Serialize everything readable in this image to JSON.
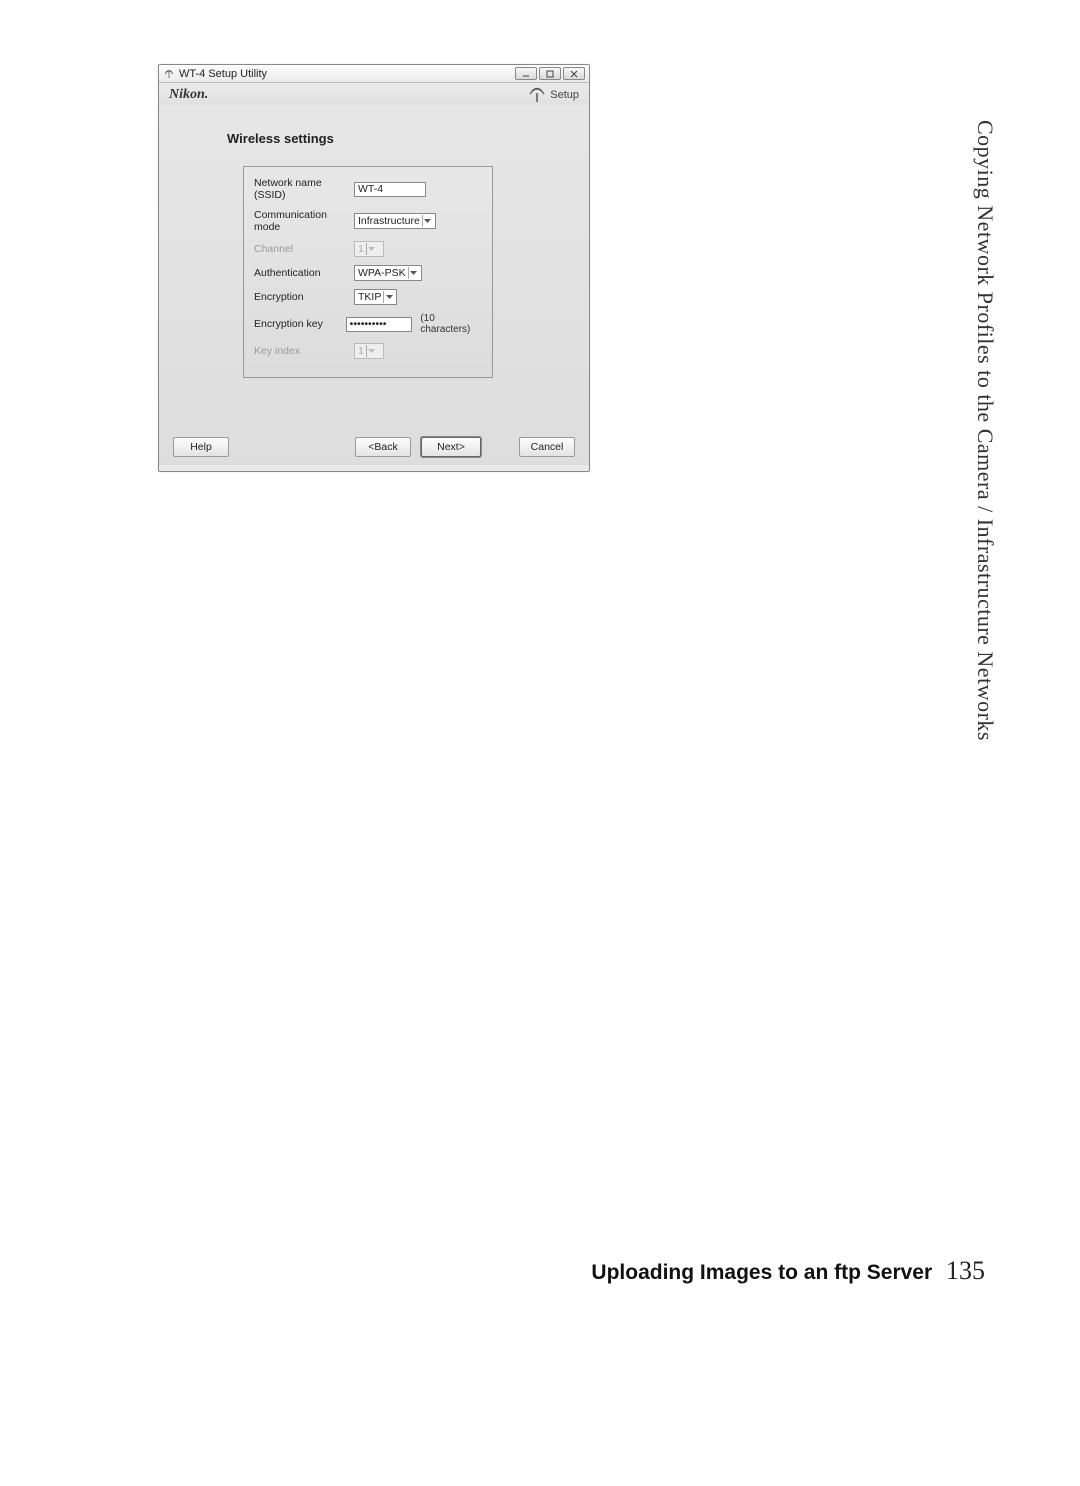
{
  "sidebar_text": "Copying Network Profiles to the Camera / Infrastructure Networks",
  "footer": {
    "section": "Uploading Images to an ftp Server",
    "page": "135"
  },
  "dialog": {
    "title": "WT-4 Setup Utility",
    "brand": "Nikon.",
    "setup_label": "Setup",
    "heading": "Wireless settings",
    "fields": {
      "ssid_label": "Network name (SSID)",
      "ssid_value": "WT-4",
      "commmode_label": "Communication mode",
      "commmode_value": "Infrastructure",
      "channel_label": "Channel",
      "channel_value": "1",
      "auth_label": "Authentication",
      "auth_value": "WPA-PSK",
      "encryption_label": "Encryption",
      "encryption_value": "TKIP",
      "enckey_label": "Encryption key",
      "enckey_value": "••••••••••",
      "enckey_hint": "(10 characters)",
      "keyindex_label": "Key index",
      "keyindex_value": "1"
    },
    "buttons": {
      "help": "Help",
      "back": "<Back",
      "next": "Next>",
      "cancel": "Cancel"
    }
  }
}
